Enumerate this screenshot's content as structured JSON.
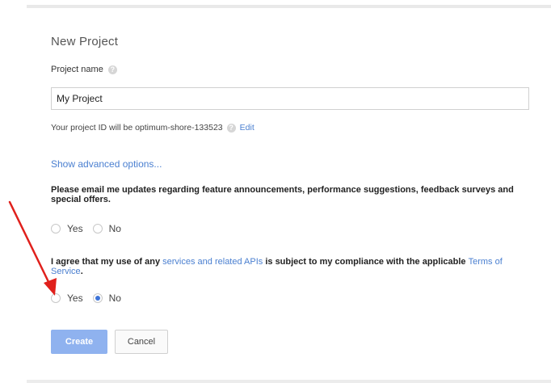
{
  "dialog": {
    "title": "New Project",
    "project_name_label": "Project name",
    "project_name_value": "My Project",
    "project_id_text": "Your project ID will be optimum-shore-133523",
    "edit_link": "Edit",
    "advanced_link": "Show advanced options...",
    "email_question": "Please email me updates regarding feature announcements, performance suggestions, feedback surveys and special offers.",
    "email_options": {
      "yes": "Yes",
      "no": "No",
      "selected": "none"
    },
    "agree_prefix": "I agree that my use of any ",
    "agree_link": "services and related APIs",
    "agree_middle": " is subject to my compliance with the applicable ",
    "agree_terms_link": "Terms of Service",
    "agree_suffix": ".",
    "agree_options": {
      "yes": "Yes",
      "no": "No",
      "selected": "No"
    },
    "create_label": "Create",
    "cancel_label": "Cancel"
  },
  "colors": {
    "link": "#4a7fd0",
    "primary_button": "#8fb2ef",
    "radio_selected": "#3d74d8",
    "annotation_arrow": "#e0201c"
  },
  "icons": {
    "help": "help-circle-icon",
    "annotation": "red-arrow-icon"
  }
}
